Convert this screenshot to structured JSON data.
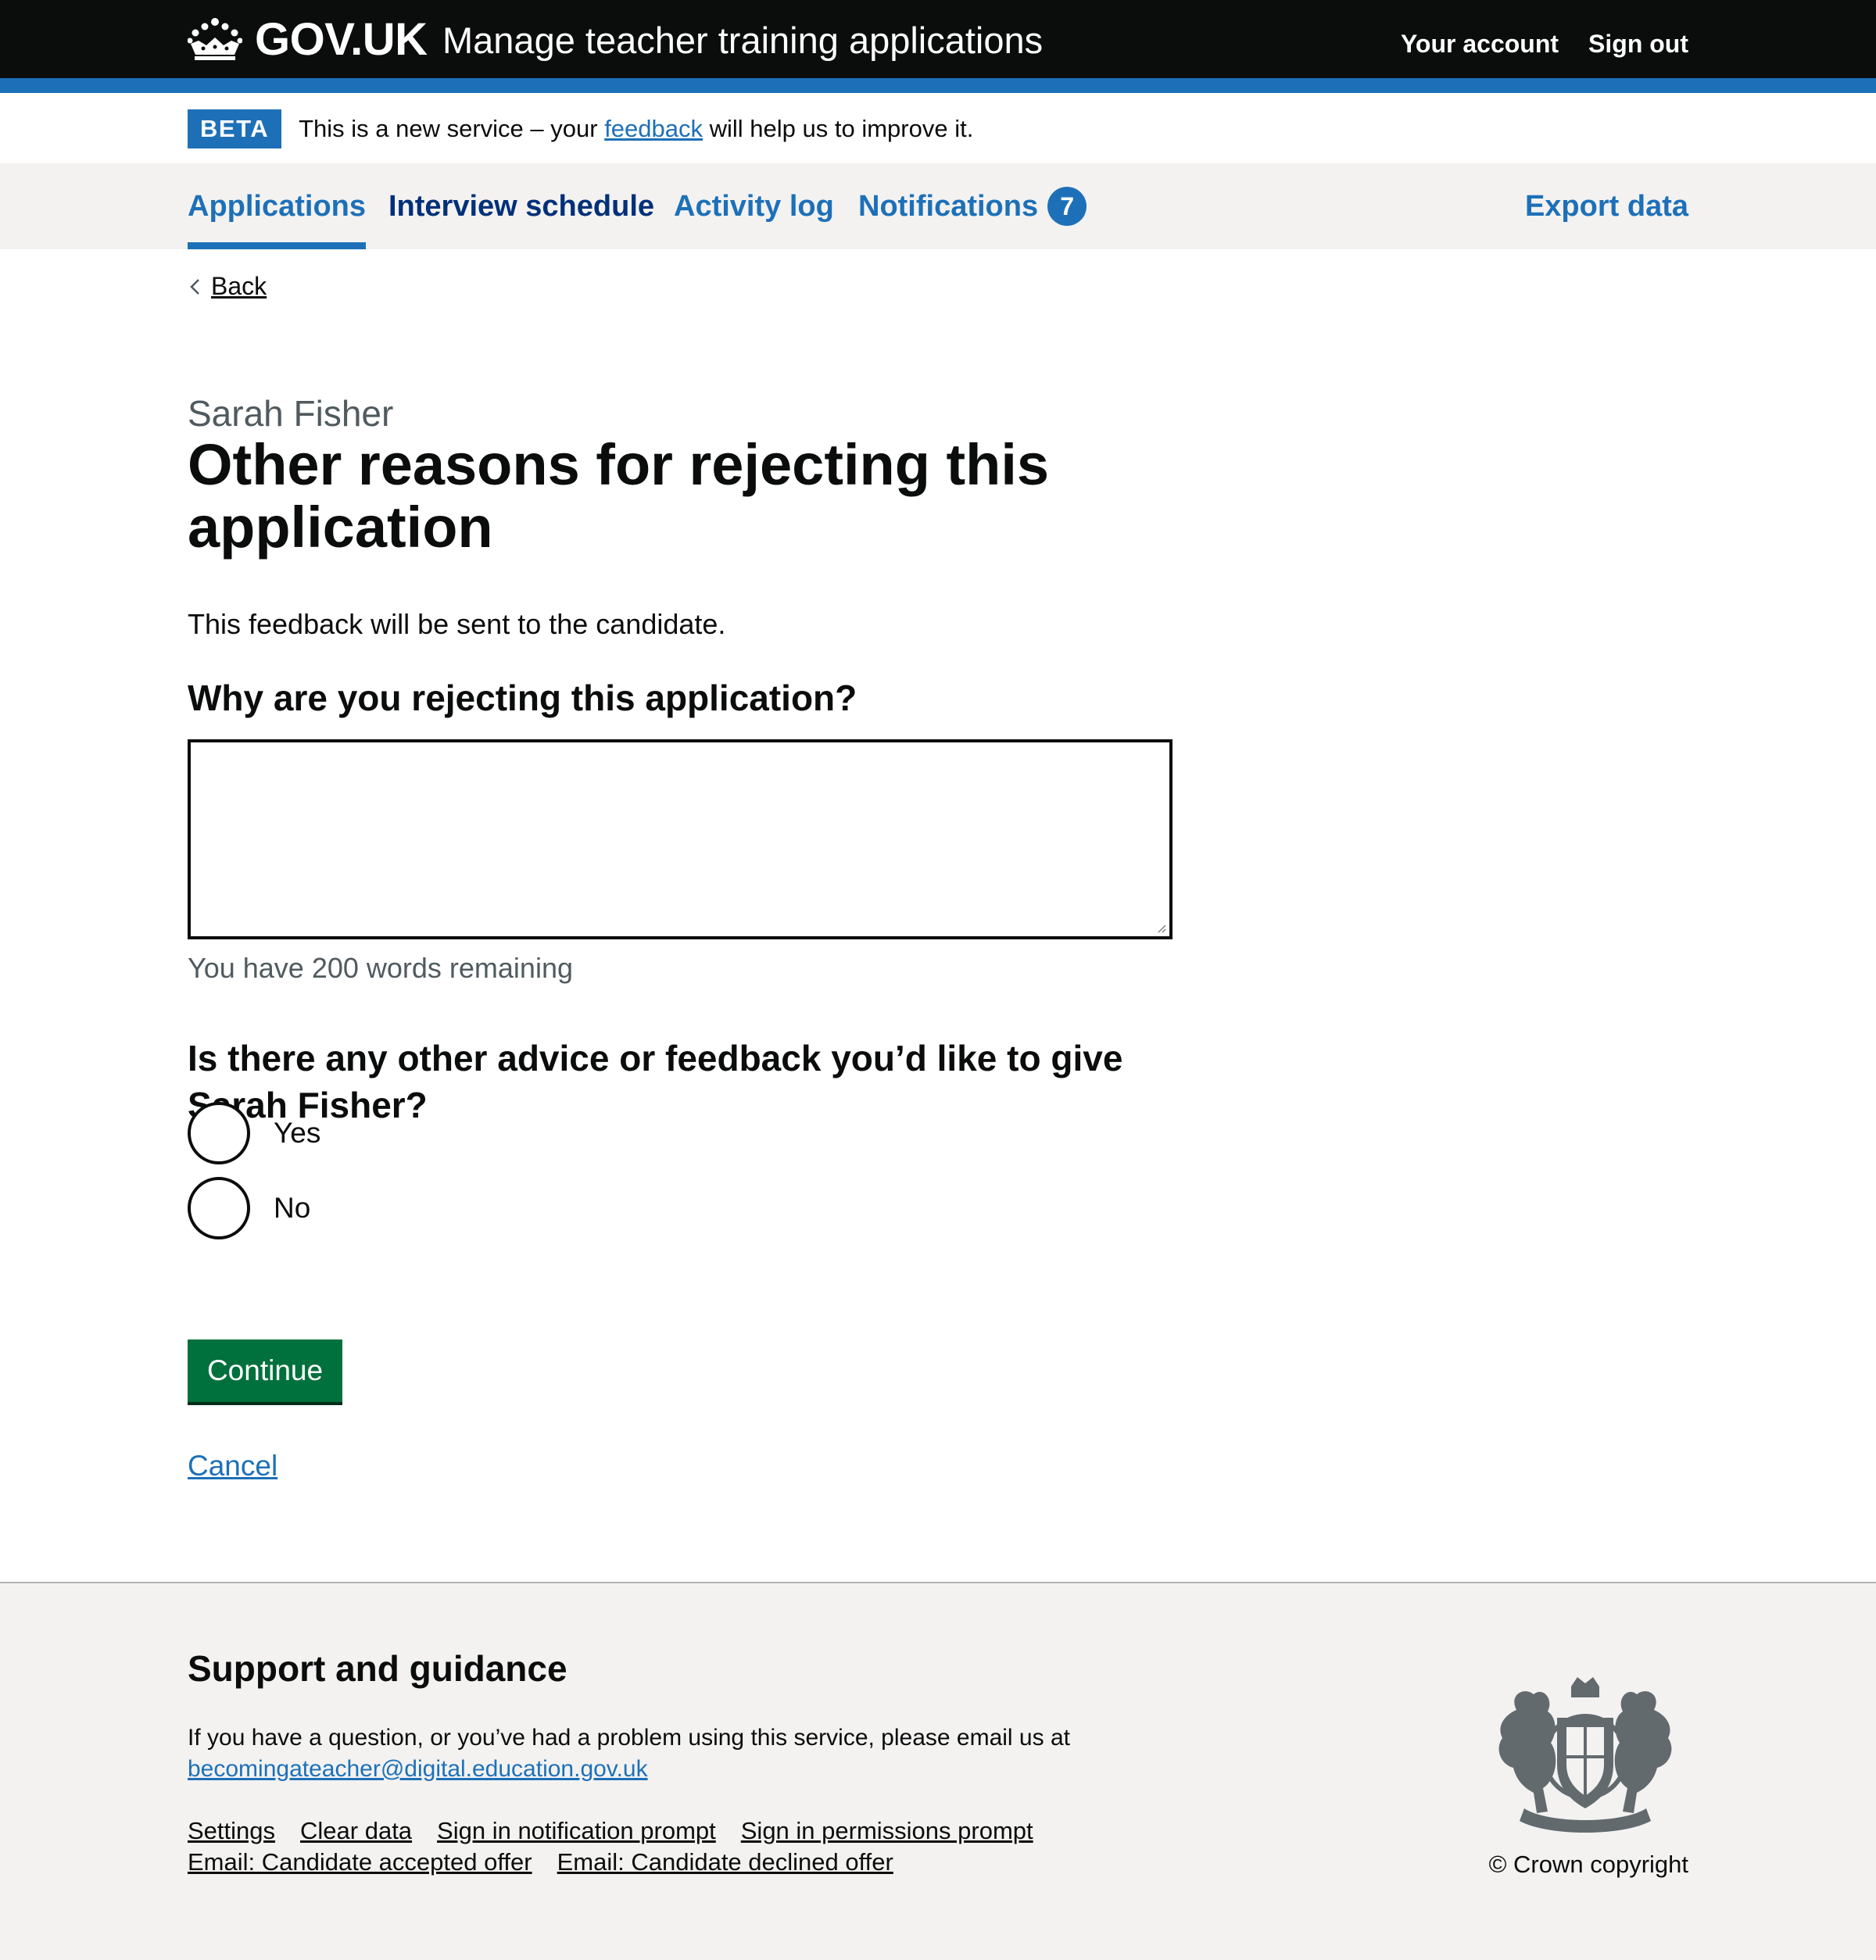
{
  "header": {
    "logo_text": "GOV.UK",
    "service_name": "Manage teacher training applications",
    "account_link": "Your account",
    "signout_link": "Sign out"
  },
  "phase_banner": {
    "tag": "BETA",
    "text_before": "This is a new service – your ",
    "link": "feedback",
    "text_after": " will help us to improve it."
  },
  "nav": {
    "items": [
      {
        "label": "Applications",
        "current": true
      },
      {
        "label": "Interview schedule"
      },
      {
        "label": "Activity log"
      },
      {
        "label": "Notifications",
        "count": "7"
      }
    ],
    "export": "Export data"
  },
  "back_link": "Back",
  "main": {
    "caption": "Sarah Fisher",
    "title": "Other reasons for rejecting this application",
    "lede": "This feedback will be sent to the candidate.",
    "question1": "Why are you rejecting this application?",
    "textarea_value": "",
    "word_count_hint": "You have 200 words remaining",
    "question2": "Is there any other advice or feedback you’d like to give Sarah Fisher?",
    "radios": [
      {
        "label": "Yes",
        "checked": false
      },
      {
        "label": "No",
        "checked": false
      }
    ],
    "continue_button": "Continue",
    "cancel_link": "Cancel"
  },
  "footer": {
    "heading": "Support and guidance",
    "text": "If you have a question, or you’ve had a problem using this service, please email us at",
    "email": "becomingateacher@digital.education.gov.uk",
    "links": [
      "Settings",
      "Clear data",
      "Sign in notification prompt",
      "Sign in permissions prompt",
      "Email: Candidate accepted offer",
      "Email: Candidate declined offer"
    ],
    "copyright": "© Crown copyright"
  },
  "colors": {
    "brand_blue": "#1d70b8",
    "header_black": "#0b0c0c",
    "button_green": "#00703c",
    "footer_grey": "#f3f2f1"
  }
}
